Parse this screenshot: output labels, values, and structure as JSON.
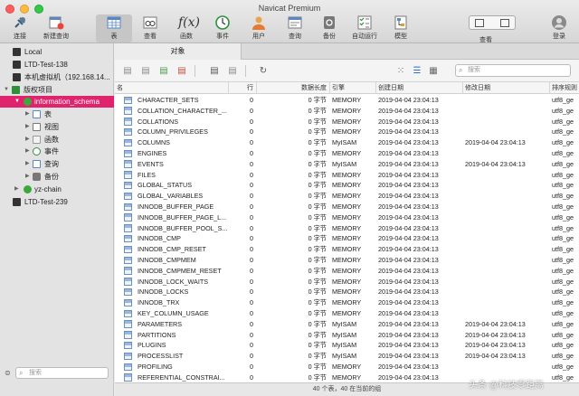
{
  "window": {
    "title": "Navicat Premium"
  },
  "toolbar": {
    "items": [
      {
        "label": "连接",
        "icon": "plug-icon"
      },
      {
        "label": "新建查询",
        "icon": "new-query-icon"
      },
      {
        "label": "表",
        "icon": "table-icon"
      },
      {
        "label": "查看",
        "icon": "view-icon"
      },
      {
        "label": "函数",
        "icon": "function-icon"
      },
      {
        "label": "事件",
        "icon": "clock-icon"
      },
      {
        "label": "用户",
        "icon": "user-icon"
      },
      {
        "label": "查询",
        "icon": "query-icon"
      },
      {
        "label": "备份",
        "icon": "backup-icon"
      },
      {
        "label": "自动运行",
        "icon": "checklist-icon"
      },
      {
        "label": "模型",
        "icon": "model-icon"
      }
    ],
    "view_label": "查看",
    "logout_label": "登录"
  },
  "sidebar": {
    "items": [
      {
        "label": "Local"
      },
      {
        "label": "LTD-Test-138"
      },
      {
        "label": "本机虚拟机（192.168.14..."
      },
      {
        "label": "版权项目"
      },
      {
        "label": "information_schema"
      },
      {
        "label": "表"
      },
      {
        "label": "视图"
      },
      {
        "label": "函数"
      },
      {
        "label": "事件"
      },
      {
        "label": "查询"
      },
      {
        "label": "备份"
      },
      {
        "label": "yz-chain"
      },
      {
        "label": "LTD-Test-239"
      }
    ],
    "search_placeholder": "搜索"
  },
  "main": {
    "tab_label": "对象",
    "search_placeholder": "搜索",
    "columns": [
      "名",
      "行",
      "数据长度",
      "引擎",
      "创建日期",
      "修改日期",
      "排序规则"
    ],
    "rows": [
      {
        "name": "CHARACTER_SETS",
        "rows": "0",
        "size": "0 字节",
        "engine": "MEMORY",
        "created": "2019-04-04 23:04:13",
        "modified": "",
        "collation": "utf8_ge"
      },
      {
        "name": "COLLATION_CHARACTER_...",
        "rows": "0",
        "size": "0 字节",
        "engine": "MEMORY",
        "created": "2019-04-04 23:04:13",
        "modified": "",
        "collation": "utf8_ge"
      },
      {
        "name": "COLLATIONS",
        "rows": "0",
        "size": "0 字节",
        "engine": "MEMORY",
        "created": "2019-04-04 23:04:13",
        "modified": "",
        "collation": "utf8_ge"
      },
      {
        "name": "COLUMN_PRIVILEGES",
        "rows": "0",
        "size": "0 字节",
        "engine": "MEMORY",
        "created": "2019-04-04 23:04:13",
        "modified": "",
        "collation": "utf8_ge"
      },
      {
        "name": "COLUMNS",
        "rows": "0",
        "size": "0 字节",
        "engine": "MyISAM",
        "created": "2019-04-04 23:04:13",
        "modified": "2019-04-04 23:04:13",
        "collation": "utf8_ge"
      },
      {
        "name": "ENGINES",
        "rows": "0",
        "size": "0 字节",
        "engine": "MEMORY",
        "created": "2019-04-04 23:04:13",
        "modified": "",
        "collation": "utf8_ge"
      },
      {
        "name": "EVENTS",
        "rows": "0",
        "size": "0 字节",
        "engine": "MyISAM",
        "created": "2019-04-04 23:04:13",
        "modified": "2019-04-04 23:04:13",
        "collation": "utf8_ge"
      },
      {
        "name": "FILES",
        "rows": "0",
        "size": "0 字节",
        "engine": "MEMORY",
        "created": "2019-04-04 23:04:13",
        "modified": "",
        "collation": "utf8_ge"
      },
      {
        "name": "GLOBAL_STATUS",
        "rows": "0",
        "size": "0 字节",
        "engine": "MEMORY",
        "created": "2019-04-04 23:04:13",
        "modified": "",
        "collation": "utf8_ge"
      },
      {
        "name": "GLOBAL_VARIABLES",
        "rows": "0",
        "size": "0 字节",
        "engine": "MEMORY",
        "created": "2019-04-04 23:04:13",
        "modified": "",
        "collation": "utf8_ge"
      },
      {
        "name": "INNODB_BUFFER_PAGE",
        "rows": "0",
        "size": "0 字节",
        "engine": "MEMORY",
        "created": "2019-04-04 23:04:13",
        "modified": "",
        "collation": "utf8_ge"
      },
      {
        "name": "INNODB_BUFFER_PAGE_L...",
        "rows": "0",
        "size": "0 字节",
        "engine": "MEMORY",
        "created": "2019-04-04 23:04:13",
        "modified": "",
        "collation": "utf8_ge"
      },
      {
        "name": "INNODB_BUFFER_POOL_S...",
        "rows": "0",
        "size": "0 字节",
        "engine": "MEMORY",
        "created": "2019-04-04 23:04:13",
        "modified": "",
        "collation": "utf8_ge"
      },
      {
        "name": "INNODB_CMP",
        "rows": "0",
        "size": "0 字节",
        "engine": "MEMORY",
        "created": "2019-04-04 23:04:13",
        "modified": "",
        "collation": "utf8_ge"
      },
      {
        "name": "INNODB_CMP_RESET",
        "rows": "0",
        "size": "0 字节",
        "engine": "MEMORY",
        "created": "2019-04-04 23:04:13",
        "modified": "",
        "collation": "utf8_ge"
      },
      {
        "name": "INNODB_CMPMEM",
        "rows": "0",
        "size": "0 字节",
        "engine": "MEMORY",
        "created": "2019-04-04 23:04:13",
        "modified": "",
        "collation": "utf8_ge"
      },
      {
        "name": "INNODB_CMPMEM_RESET",
        "rows": "0",
        "size": "0 字节",
        "engine": "MEMORY",
        "created": "2019-04-04 23:04:13",
        "modified": "",
        "collation": "utf8_ge"
      },
      {
        "name": "INNODB_LOCK_WAITS",
        "rows": "0",
        "size": "0 字节",
        "engine": "MEMORY",
        "created": "2019-04-04 23:04:13",
        "modified": "",
        "collation": "utf8_ge"
      },
      {
        "name": "INNODB_LOCKS",
        "rows": "0",
        "size": "0 字节",
        "engine": "MEMORY",
        "created": "2019-04-04 23:04:13",
        "modified": "",
        "collation": "utf8_ge"
      },
      {
        "name": "INNODB_TRX",
        "rows": "0",
        "size": "0 字节",
        "engine": "MEMORY",
        "created": "2019-04-04 23:04:13",
        "modified": "",
        "collation": "utf8_ge"
      },
      {
        "name": "KEY_COLUMN_USAGE",
        "rows": "0",
        "size": "0 字节",
        "engine": "MEMORY",
        "created": "2019-04-04 23:04:13",
        "modified": "",
        "collation": "utf8_ge"
      },
      {
        "name": "PARAMETERS",
        "rows": "0",
        "size": "0 字节",
        "engine": "MyISAM",
        "created": "2019-04-04 23:04:13",
        "modified": "2019-04-04 23:04:13",
        "collation": "utf8_ge"
      },
      {
        "name": "PARTITIONS",
        "rows": "0",
        "size": "0 字节",
        "engine": "MyISAM",
        "created": "2019-04-04 23:04:13",
        "modified": "2019-04-04 23:04:13",
        "collation": "utf8_ge"
      },
      {
        "name": "PLUGINS",
        "rows": "0",
        "size": "0 字节",
        "engine": "MyISAM",
        "created": "2019-04-04 23:04:13",
        "modified": "2019-04-04 23:04:13",
        "collation": "utf8_ge"
      },
      {
        "name": "PROCESSLIST",
        "rows": "0",
        "size": "0 字节",
        "engine": "MyISAM",
        "created": "2019-04-04 23:04:13",
        "modified": "2019-04-04 23:04:13",
        "collation": "utf8_ge"
      },
      {
        "name": "PROFILING",
        "rows": "0",
        "size": "0 字节",
        "engine": "MEMORY",
        "created": "2019-04-04 23:04:13",
        "modified": "",
        "collation": "utf8_ge"
      },
      {
        "name": "REFERENTIAL_CONSTRAI...",
        "rows": "0",
        "size": "0 字节",
        "engine": "MEMORY",
        "created": "2019-04-04 23:04:13",
        "modified": "",
        "collation": "utf8_ge"
      }
    ]
  },
  "status": {
    "text": "40 个表，40 在当前的组"
  },
  "watermark": {
    "text": "头条 @科技零距离"
  },
  "colors": {
    "accent": "#e0236d",
    "db_green": "#3aa83a"
  }
}
